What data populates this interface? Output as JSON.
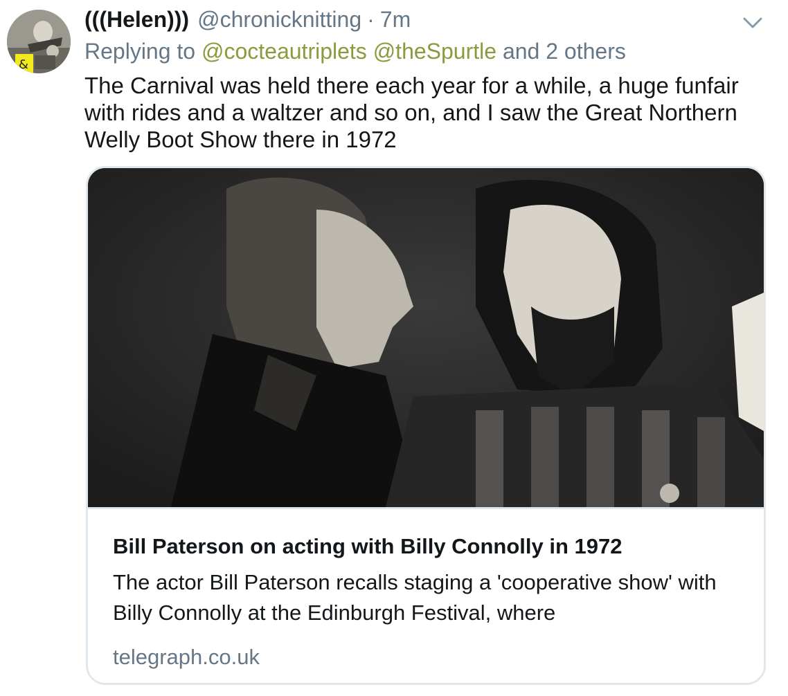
{
  "tweet": {
    "display_name": "(((Helen)))",
    "handle": "@chronicknitting",
    "separator": "·",
    "time": "7m",
    "reply": {
      "prefix": "Replying to",
      "mentions": [
        "@cocteautriplets",
        "@theSpurtle"
      ],
      "suffix": "and 2 others"
    },
    "text": "The Carnival was held there each year for a while, a huge funfair with rides and a waltzer and so on, and I saw the Great Northern Welly Boot Show there in 1972"
  },
  "card": {
    "title": "Bill Paterson on acting with Billy Connolly in 1972",
    "description": "The actor Bill Paterson recalls staging a 'cooperative show' with Billy Connolly at the Edinburgh Festival, where",
    "domain": "telegraph.co.uk"
  },
  "icons": {
    "menu": "chevron-down-icon",
    "avatar_badge": "ampersand"
  },
  "colors": {
    "text_primary": "#14171a",
    "text_secondary": "#657786",
    "mention": "#8a9a3c",
    "card_border": "#e1e8ed"
  }
}
